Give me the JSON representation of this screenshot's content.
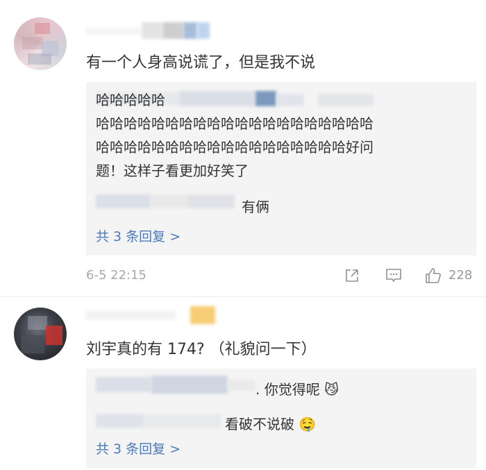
{
  "comments": [
    {
      "text": "有一个人身高说谎了，但是我不说",
      "replies": [
        {
          "text": "哈哈哈哈哈\n哈哈哈哈哈哈哈哈哈哈哈哈哈哈哈哈哈哈哈哈\n哈哈哈哈哈哈哈哈哈哈哈哈哈哈哈哈哈哈好问\n题！这样子看更加好笑了"
        },
        {
          "text": "有俩"
        }
      ],
      "more_replies": "共 3 条回复 >",
      "time": "6-5 22:15",
      "like_count": "228"
    },
    {
      "text": "刘宇真的有 174? （礼貌问一下）",
      "replies": [
        {
          "text": ". 你觉得呢",
          "emoji": "😼"
        },
        {
          "text": "看破不说破",
          "emoji": "🤤"
        }
      ],
      "more_replies": "共 3 条回复 >"
    }
  ],
  "icons": {
    "share": "share-icon",
    "comment": "comment-icon",
    "like": "thumbs-up-icon"
  },
  "colors": {
    "link": "#4a7ab8",
    "meta": "#a8a8a8",
    "reply_bg": "#f4f4f4"
  }
}
